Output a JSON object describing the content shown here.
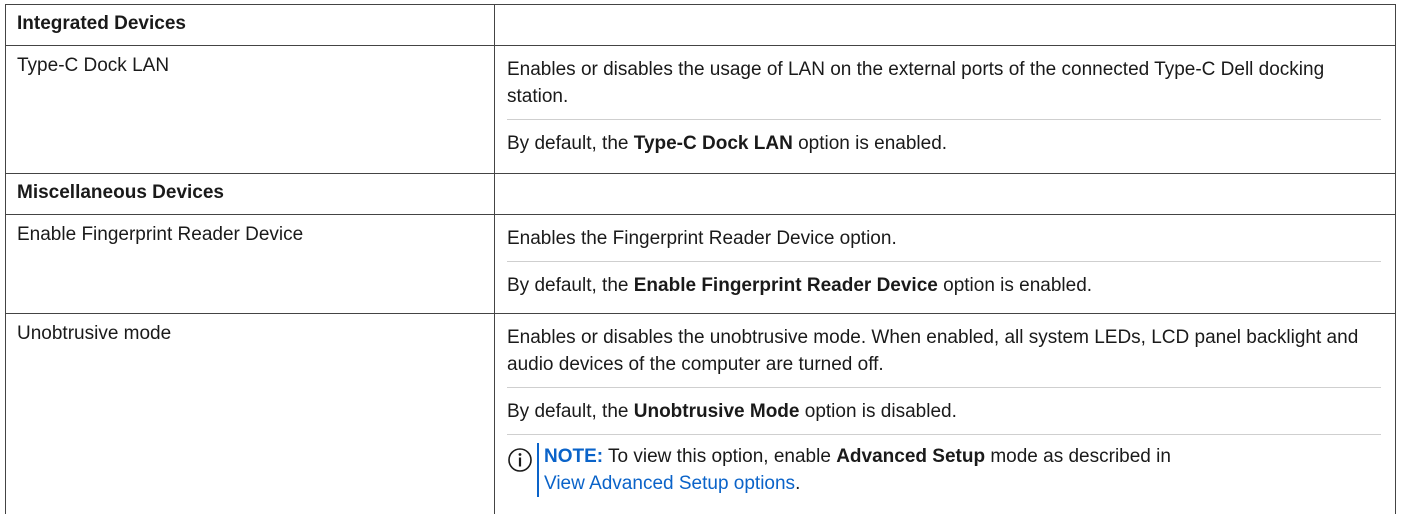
{
  "sections": [
    {
      "title": "Integrated Devices",
      "rows": [
        {
          "name": "Type-C Dock LAN",
          "description": "Enables or disables the usage of LAN on the external ports of the connected Type-C Dell docking station.",
          "default_prefix": "By default, the ",
          "default_option": "Type-C Dock LAN",
          "default_suffix": " option is enabled."
        }
      ]
    },
    {
      "title": "Miscellaneous Devices",
      "rows": [
        {
          "name": "Enable Fingerprint Reader Device",
          "description": "Enables the Fingerprint Reader Device option.",
          "default_prefix": "By default, the ",
          "default_option": "Enable Fingerprint Reader Device",
          "default_suffix": " option is enabled."
        },
        {
          "name": "Unobtrusive mode",
          "description": "Enables or disables the unobtrusive mode. When enabled, all system LEDs, LCD panel backlight and audio devices of the computer are turned off.",
          "default_prefix": "By default, the ",
          "default_option": "Unobtrusive Mode",
          "default_suffix": " option is disabled.",
          "note": {
            "label": "NOTE:",
            "text_before": " To view this option, enable ",
            "bold": "Advanced Setup",
            "text_after": " mode as described in",
            "link": "View Advanced Setup options",
            "end": "."
          }
        }
      ]
    }
  ],
  "colors": {
    "accent": "#0a63c9",
    "border": "#444444"
  },
  "icons": {
    "note": "info-circle-icon"
  }
}
